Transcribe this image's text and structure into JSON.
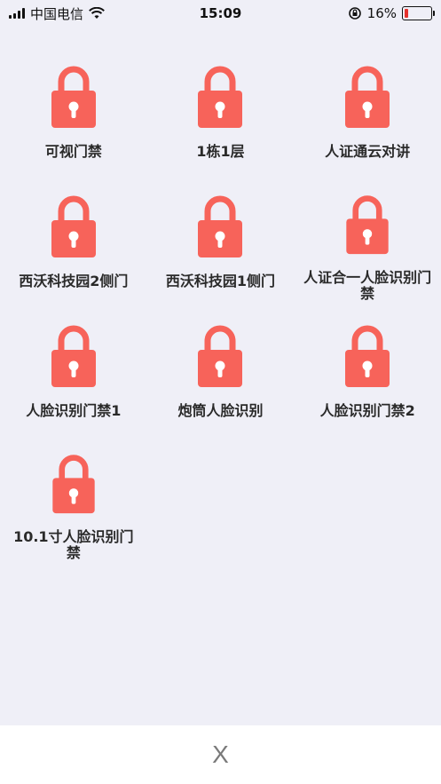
{
  "status_bar": {
    "carrier": "中国电信",
    "time": "15:09",
    "battery_percent": "16%",
    "battery_level": 0.16,
    "icons": [
      "signal-icon",
      "wifi-icon",
      "orientation-lock-icon",
      "battery-icon"
    ]
  },
  "accent_color": "#f7635a",
  "doors": [
    {
      "label": "可视门禁"
    },
    {
      "label": "1栋1层"
    },
    {
      "label": "人证通云对讲"
    },
    {
      "label": "西沃科技园2侧门"
    },
    {
      "label": "西沃科技园1侧门"
    },
    {
      "label": "人证合一人脸识别门禁"
    },
    {
      "label": "人脸识别门禁1"
    },
    {
      "label": "炮筒人脸识别"
    },
    {
      "label": "人脸识别门禁2"
    },
    {
      "label": "10.1寸人脸识别门禁"
    }
  ],
  "bottom_bar": {
    "close_label": "X"
  }
}
